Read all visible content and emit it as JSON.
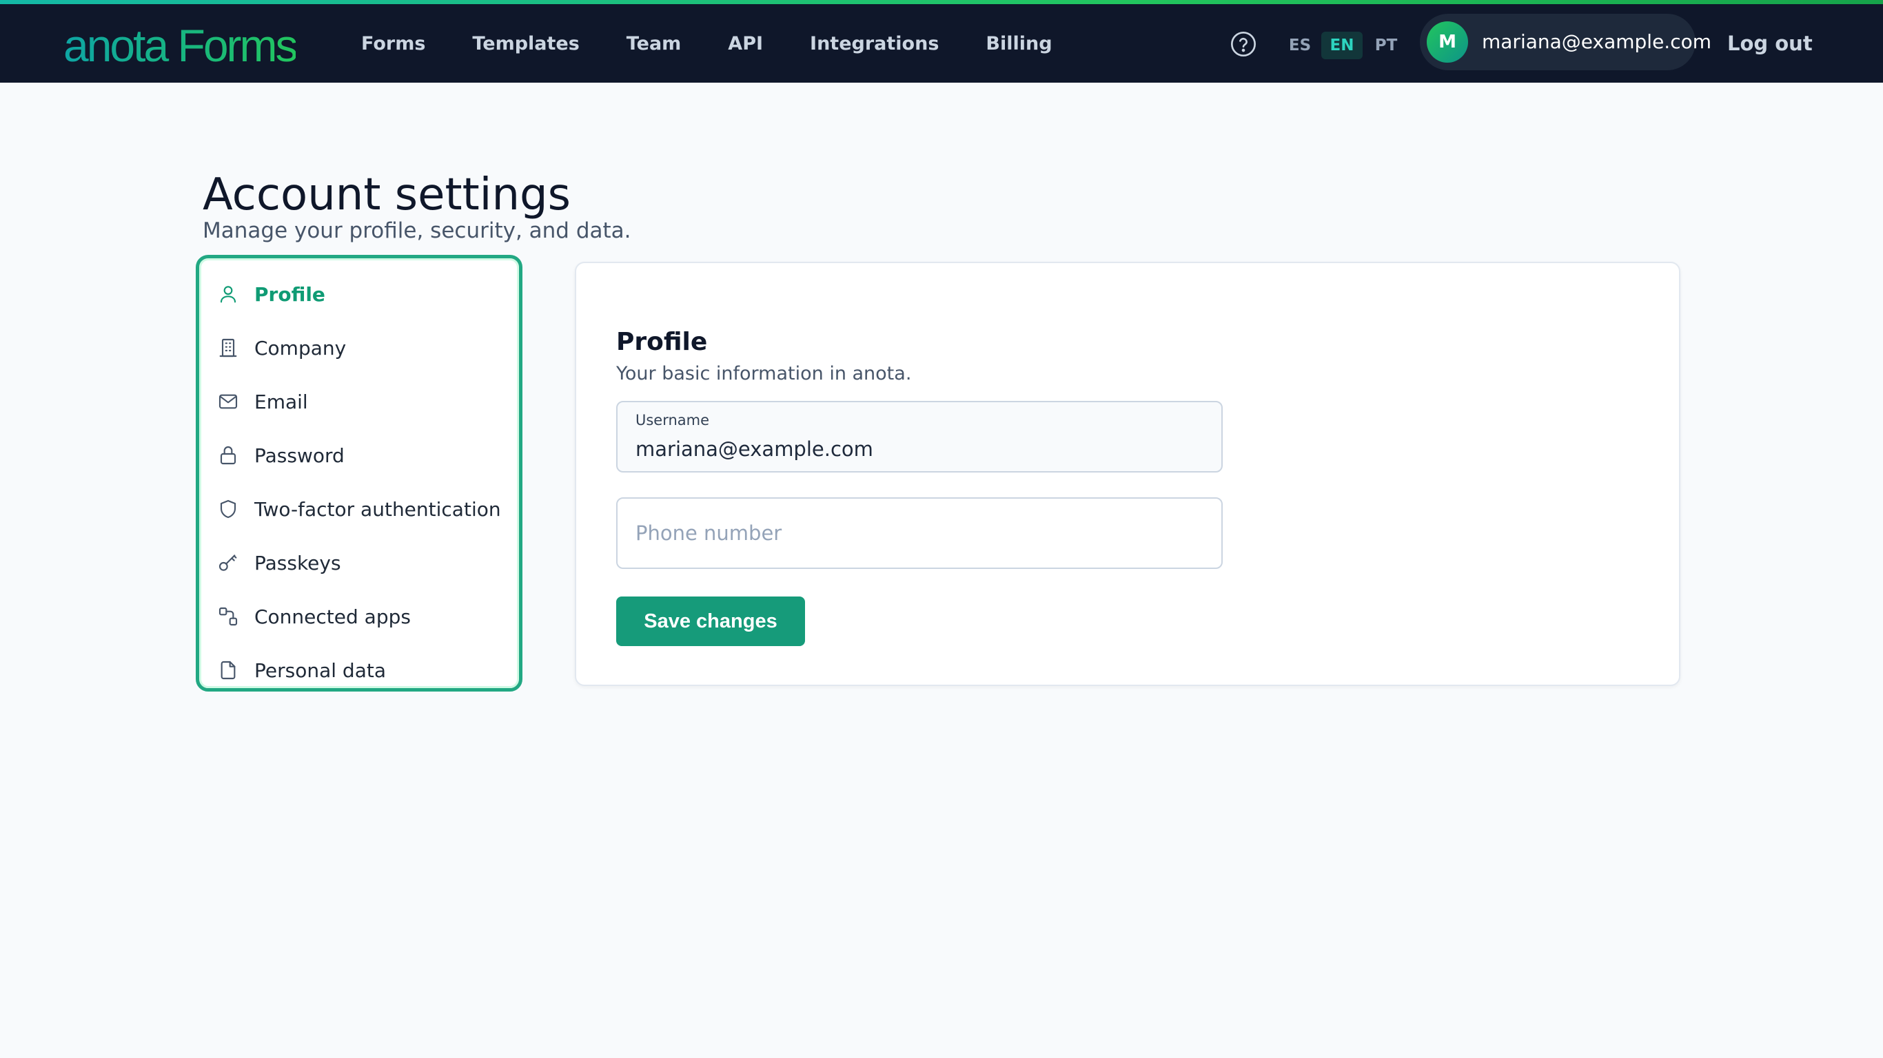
{
  "app": {
    "logo_text": "anota Forms",
    "brand_colors": [
      "#0ea5a4",
      "#22c55e"
    ]
  },
  "nav": {
    "items": [
      {
        "label": "Forms"
      },
      {
        "label": "Templates"
      },
      {
        "label": "Team"
      },
      {
        "label": "API"
      },
      {
        "label": "Integrations"
      },
      {
        "label": "Billing"
      }
    ]
  },
  "header": {
    "help_icon": "help-circle-icon",
    "languages": [
      {
        "code": "ES",
        "active": false
      },
      {
        "code": "EN",
        "active": true
      },
      {
        "code": "PT",
        "active": false
      }
    ],
    "user": {
      "avatar_initial": "M",
      "email": "mariana@example.com"
    },
    "logout_label": "Log out"
  },
  "page": {
    "title": "Account settings",
    "subtitle": "Manage your profile, security, and data."
  },
  "sidebar": {
    "items": [
      {
        "label": "Profile",
        "icon": "user-icon",
        "active": true
      },
      {
        "label": "Company",
        "icon": "building-icon",
        "active": false
      },
      {
        "label": "Email",
        "icon": "mail-icon",
        "active": false
      },
      {
        "label": "Password",
        "icon": "lock-icon",
        "active": false
      },
      {
        "label": "Two-factor authentication",
        "icon": "shield-icon",
        "active": false
      },
      {
        "label": "Passkeys",
        "icon": "key-icon",
        "active": false
      },
      {
        "label": "Connected apps",
        "icon": "connected-apps-icon",
        "active": false
      },
      {
        "label": "Personal data",
        "icon": "file-icon",
        "active": false
      }
    ]
  },
  "profile": {
    "title": "Profile",
    "subtitle": "Your basic information in anota.",
    "username_label": "Username",
    "username_value": "mariana@example.com",
    "phone_placeholder": "Phone number",
    "phone_value": "",
    "save_label": "Save changes"
  },
  "colors": {
    "accent": "#169b7a",
    "topbar": "#0f172a",
    "active_nav_text": "#0f9b74"
  }
}
